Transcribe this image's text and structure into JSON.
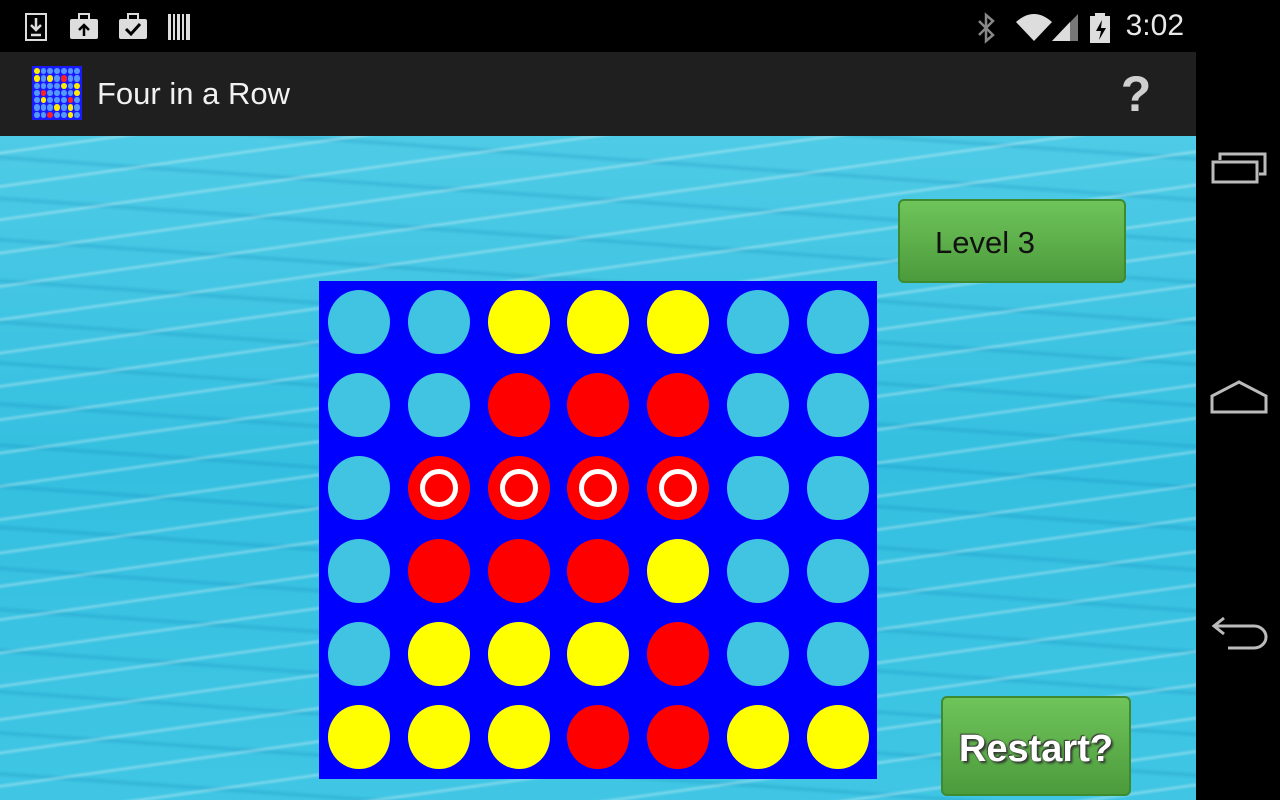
{
  "status_bar": {
    "time": "3:02",
    "icons": [
      "download-icon",
      "briefcase-upload-icon",
      "briefcase-check-icon",
      "barcode-icon",
      "bluetooth-icon",
      "wifi-icon",
      "signal-icon",
      "battery-charging-icon"
    ]
  },
  "app": {
    "title": "Four in a Row",
    "icon": "app-grid-icon",
    "help_label": "?"
  },
  "game": {
    "level_label": "Level 3",
    "restart_label": "Restart?",
    "rows": 6,
    "columns": 7,
    "board": [
      [
        "empty",
        "empty",
        "yellow",
        "yellow",
        "yellow",
        "empty",
        "empty"
      ],
      [
        "empty",
        "empty",
        "red",
        "red",
        "red",
        "empty",
        "empty"
      ],
      [
        "empty",
        "red",
        "red",
        "red",
        "red",
        "empty",
        "empty"
      ],
      [
        "empty",
        "red",
        "red",
        "red",
        "yellow",
        "empty",
        "empty"
      ],
      [
        "empty",
        "yellow",
        "yellow",
        "yellow",
        "red",
        "empty",
        "empty"
      ],
      [
        "yellow",
        "yellow",
        "yellow",
        "red",
        "red",
        "yellow",
        "yellow"
      ]
    ],
    "winning_cells": [
      [
        2,
        1
      ],
      [
        2,
        2
      ],
      [
        2,
        3
      ],
      [
        2,
        4
      ]
    ],
    "colors": {
      "board": "#0000ff",
      "red": "#ff0000",
      "yellow": "#ffff00",
      "empty": "#41c3e2",
      "button_green": "#5cae48"
    }
  },
  "nav_bar": {
    "buttons": [
      "recent-apps-icon",
      "home-icon",
      "back-icon"
    ]
  }
}
